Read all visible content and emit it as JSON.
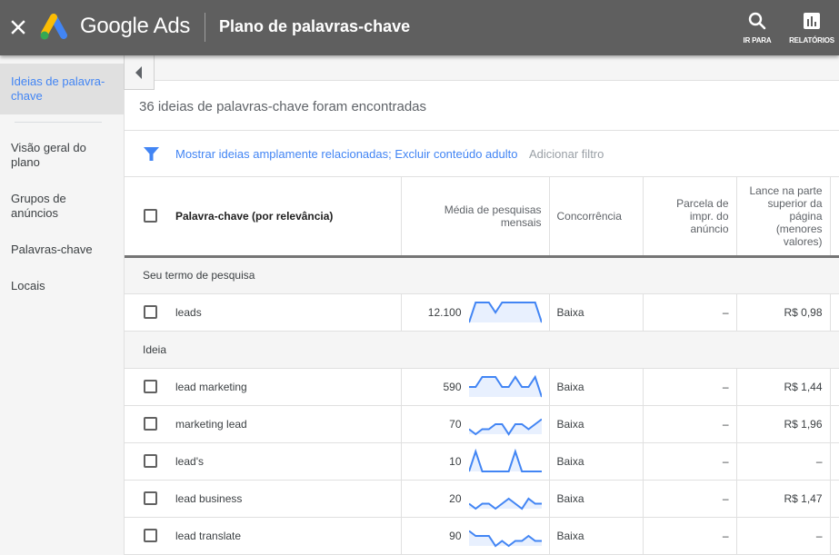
{
  "topbar": {
    "close_icon": "close-icon",
    "brand": "Google Ads",
    "title": "Plano de palavras-chave",
    "actions": [
      {
        "label": "IR PARA",
        "icon": "search-icon"
      },
      {
        "label": "RELATÓRIOS",
        "icon": "bar-chart-icon"
      }
    ]
  },
  "sidebar": {
    "items": [
      {
        "label": "Ideias de palavra-chave",
        "active": true
      },
      {
        "label": "Visão geral do plano",
        "active": false
      },
      {
        "label": "Grupos de anúncios",
        "active": false
      },
      {
        "label": "Palavras-chave",
        "active": false
      },
      {
        "label": "Locais",
        "active": false
      }
    ]
  },
  "main": {
    "found_text": "36 ideias de palavras-chave foram encontradas",
    "filter_text": "Mostrar ideias amplamente relacionadas; Excluir conteúdo adulto",
    "add_filter": "Adicionar filtro",
    "columns": {
      "keyword": "Palavra-chave (por relevância)",
      "avg_searches": "Média de pesquisas mensais",
      "competition": "Concorrência",
      "impr_share": "Parcela de impr. do anúncio",
      "top_bid_low": "Lance na parte superior da página (menores valores)"
    },
    "sections": [
      {
        "label": "Seu termo de pesquisa",
        "rows": [
          {
            "keyword": "leads",
            "avg": "12.100",
            "trend": [
              1,
              5,
              5,
              5,
              3,
              5,
              5,
              5,
              5,
              5,
              5,
              1
            ],
            "competition": "Baixa",
            "impr_share": "–",
            "top_bid_low": "R$ 0,98"
          }
        ]
      },
      {
        "label": "Ideia",
        "rows": [
          {
            "keyword": "lead marketing",
            "avg": "590",
            "trend": [
              3,
              3,
              5,
              5,
              5,
              3,
              3,
              5,
              3,
              3,
              5,
              1
            ],
            "competition": "Baixa",
            "impr_share": "–",
            "top_bid_low": "R$ 1,44"
          },
          {
            "keyword": "marketing lead",
            "avg": "70",
            "trend": [
              2,
              1,
              2,
              2,
              3,
              3,
              1,
              3,
              3,
              2,
              3,
              4
            ],
            "competition": "Baixa",
            "impr_share": "–",
            "top_bid_low": "R$ 1,96"
          },
          {
            "keyword": "lead's",
            "avg": "10",
            "trend": [
              1,
              5,
              1,
              1,
              1,
              1,
              1,
              5,
              1,
              1,
              1,
              1
            ],
            "competition": "Baixa",
            "impr_share": "–",
            "top_bid_low": "–"
          },
          {
            "keyword": "lead business",
            "avg": "20",
            "trend": [
              2,
              1,
              2,
              2,
              1,
              2,
              3,
              2,
              1,
              3,
              2,
              2
            ],
            "competition": "Baixa",
            "impr_share": "–",
            "top_bid_low": "R$ 1,47"
          },
          {
            "keyword": "lead translate",
            "avg": "90",
            "trend": [
              4,
              3,
              3,
              3,
              1,
              2,
              1,
              2,
              2,
              3,
              2,
              2
            ],
            "competition": "Baixa",
            "impr_share": "–",
            "top_bid_low": "–"
          }
        ]
      }
    ]
  },
  "colors": {
    "topbar": "#5f5f5f",
    "accent": "#4285f4",
    "spark_line": "#4285f4",
    "spark_fill": "#e8f0fe"
  }
}
